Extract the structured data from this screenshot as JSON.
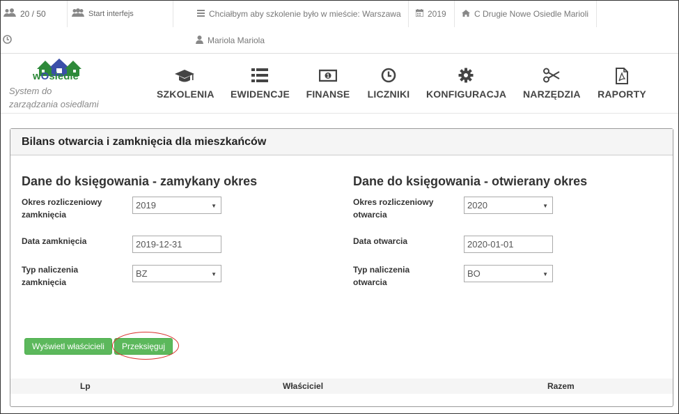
{
  "topbar": {
    "users_count": "20 / 50",
    "start_label": "Start interfejs",
    "wish_text": "Chciałbym aby szkolenie było w mieście: Warszawa",
    "year": "2019",
    "estate": "C Drugie Nowe Osiedle Marioli",
    "user_name": "Mariola Mariola"
  },
  "logo": {
    "text_w": "w",
    "text_o": "O",
    "text_rest": "siedle",
    "tagline_line1": "System do",
    "tagline_line2": "zarządzania osiedlami"
  },
  "nav": {
    "items": [
      {
        "label": "SZKOLENIA",
        "icon": "graduation-cap-icon"
      },
      {
        "label": "EWIDENCJE",
        "icon": "list-icon"
      },
      {
        "label": "FINANSE",
        "icon": "money-icon"
      },
      {
        "label": "LICZNIKI",
        "icon": "clock-icon"
      },
      {
        "label": "KONFIGURACJA",
        "icon": "gear-icon"
      },
      {
        "label": "NARZĘDZIA",
        "icon": "scissors-icon"
      },
      {
        "label": "RAPORTY",
        "icon": "pdf-file-icon"
      }
    ]
  },
  "panel": {
    "title": "Bilans otwarcia i zamknięcia dla mieszkańców",
    "closing": {
      "title": "Dane do księgowania - zamykany okres",
      "period_label_1": "Okres rozliczeniowy",
      "period_label_2": "zamknięcia",
      "period_value": "2019",
      "date_label": "Data zamknięcia",
      "date_value": "2019-12-31",
      "type_label_1": "Typ naliczenia",
      "type_label_2": "zamknięcia",
      "type_value": "BZ"
    },
    "opening": {
      "title": "Dane do księgowania - otwierany okres",
      "period_label_1": "Okres rozliczeniowy",
      "period_label_2": "otwarcia",
      "period_value": "2020",
      "date_label": "Data otwarcia",
      "date_value": "2020-01-01",
      "type_label_1": "Typ naliczenia",
      "type_label_2": "otwarcia",
      "type_value": "BO"
    },
    "buttons": {
      "show_owners": "Wyświetl właścicieli",
      "repost": "Przeksięguj"
    },
    "table": {
      "columns": [
        "Lp",
        "Właściciel",
        "Razem"
      ]
    }
  },
  "colors": {
    "button_green": "#5cb85c",
    "highlight_red": "#d9302c",
    "logo_green": "#2e8a3a",
    "logo_blue": "#3b4fa8"
  }
}
